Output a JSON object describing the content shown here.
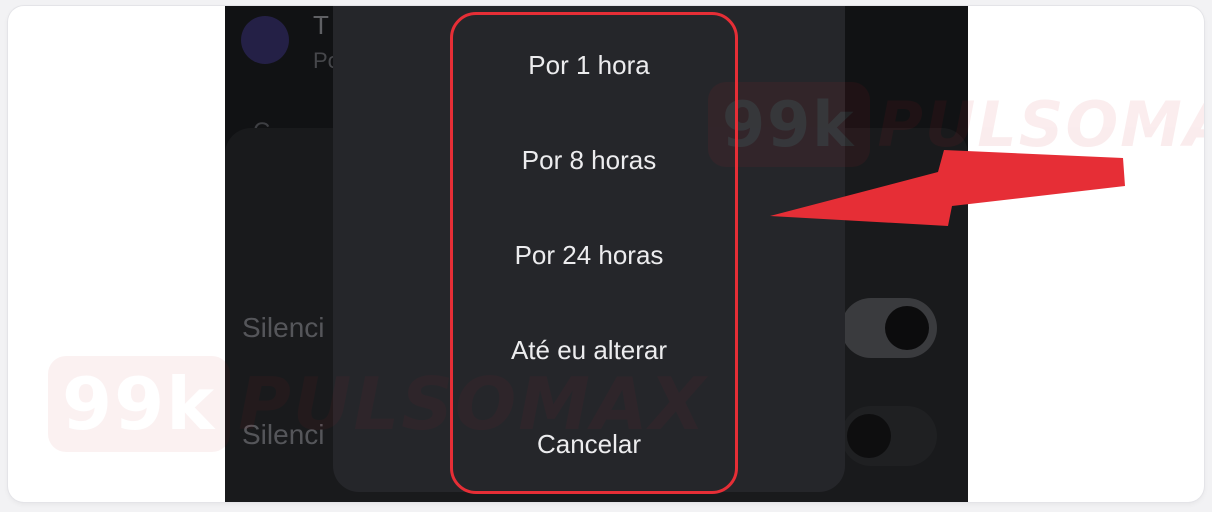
{
  "background_screen": {
    "chat_title_partial": "T",
    "chat_subtitle_partial": "Po",
    "section_initial": "C",
    "rows": [
      {
        "label": "Silenci",
        "toggle_on": true
      },
      {
        "label": "Silenci",
        "toggle_on": false
      }
    ]
  },
  "mute_dialog": {
    "options": [
      "Por 1 hora",
      "Por 8 horas",
      "Por 24 horas",
      "Até eu alterar"
    ],
    "cancel_label": "Cancelar"
  },
  "watermark": {
    "badge": "99k",
    "text": "PULSOMAX"
  },
  "colors": {
    "highlight": "#e62e36",
    "arrow": "#e62e36",
    "dialog_bg": "#25262a"
  }
}
